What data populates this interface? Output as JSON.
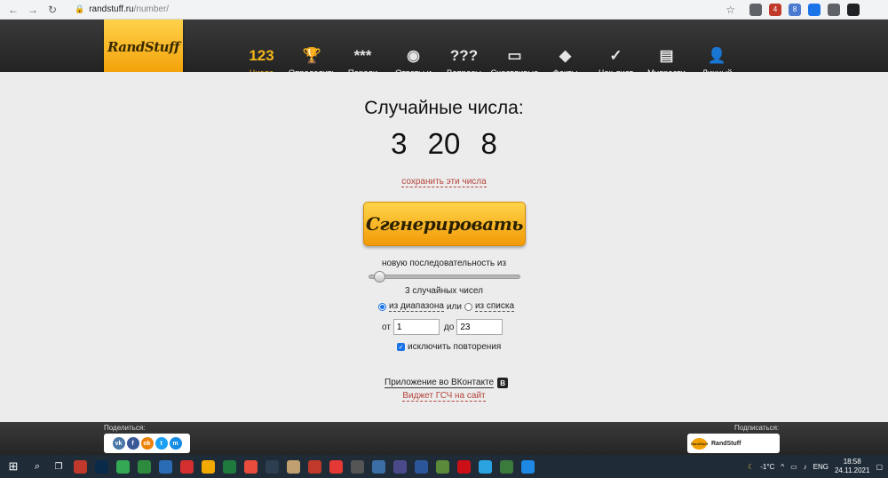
{
  "browser": {
    "url_host": "randstuff.ru",
    "url_path": "/number/",
    "extensions": [
      {
        "label": "",
        "color": "#5f6368"
      },
      {
        "label": "4",
        "color": "#c0392b"
      },
      {
        "label": "8",
        "color": "#4a7bd0"
      },
      {
        "label": "",
        "color": "#1a73e8"
      },
      {
        "label": "",
        "color": "#5f6368"
      },
      {
        "label": "",
        "color": "#202124"
      }
    ]
  },
  "site": {
    "logo": "RandStuff",
    "menu": [
      {
        "icon": "123",
        "icon_name": "numbers-icon",
        "label": "Числа",
        "active": true
      },
      {
        "icon": "🏆",
        "icon_name": "trophy-icon",
        "label": "Определить\nпобедителя",
        "active": false
      },
      {
        "icon": "***",
        "icon_name": "password-icon",
        "label": "Пароли",
        "active": false
      },
      {
        "icon": "◉",
        "icon_name": "magic-ball-icon",
        "label": "Ответы и\nпредсказания",
        "active": false
      },
      {
        "icon": "???",
        "icon_name": "question-icon",
        "label": "Вопросы",
        "active": false
      },
      {
        "icon": "▭",
        "icon_name": "ticket-icon",
        "label": "Счастливые\nбилеты",
        "active": false
      },
      {
        "icon": "◆",
        "icon_name": "facts-icon",
        "label": "Факты",
        "active": false
      },
      {
        "icon": "✓",
        "icon_name": "checklist-icon",
        "label": "Чек-лист\nдел жизни",
        "active": false
      },
      {
        "icon": "▤",
        "icon_name": "scroll-icon",
        "label": "Мудрости",
        "active": false
      },
      {
        "icon": "👤",
        "icon_name": "user-icon",
        "label": "Личный\nкабинет",
        "active": false
      }
    ]
  },
  "main": {
    "title": "Случайные числа:",
    "numbers": "3 20 8",
    "save_link": "сохранить эти числа",
    "generate_label": "Сгенерировать",
    "sequence_label": "новую последовательность из",
    "slider_value": 3,
    "slider_min": 1,
    "slider_max": 50,
    "count_label": "3 случайных чисел",
    "mode_range": "из диапазона",
    "mode_or": "или",
    "mode_list": "из списка",
    "from_label": "от",
    "from_value": "1",
    "to_label": "до",
    "to_value": "23",
    "exclude_label": "исключить повторения",
    "vk_app": "Приложение во ВКонтакте",
    "vk_badge": "В",
    "widget_link": "Виджет ГСЧ на сайт"
  },
  "footer": {
    "share_label": "Поделиться:",
    "share": [
      {
        "label": "vk",
        "icon_name": "vk-icon",
        "color": "#4a76a8"
      },
      {
        "label": "f",
        "icon_name": "facebook-icon",
        "color": "#3b5998"
      },
      {
        "label": "ok",
        "icon_name": "odnoklassniki-icon",
        "color": "#ee8208"
      },
      {
        "label": "t",
        "icon_name": "twitter-icon",
        "color": "#1da1f2"
      },
      {
        "label": "m",
        "icon_name": "myworld-icon",
        "color": "#168de2"
      }
    ],
    "subscribe_label": "Подписаться:",
    "subscribe_name": "RandStuff",
    "subscribe_mini": "RandStuff"
  },
  "taskbar": {
    "apps": [
      "#c0392b",
      "#0a2a4a",
      "#34a853",
      "#2e8b3e",
      "#2a6db5",
      "#d32f2f",
      "#f2a900",
      "#1f7a3e",
      "#e74c3c",
      "#2c3e50",
      "#c0a070",
      "#c0392b",
      "#e53935",
      "#555555",
      "#3a6ea5",
      "#4a4a8a",
      "#2b579a",
      "#5a8a3a",
      "#cc0f16",
      "#2aa3e0",
      "#3a7a3a",
      "#1e88e5"
    ],
    "temperature": "-1°C",
    "language": "ENG",
    "time": "18:58",
    "date": "24.11.2021"
  }
}
